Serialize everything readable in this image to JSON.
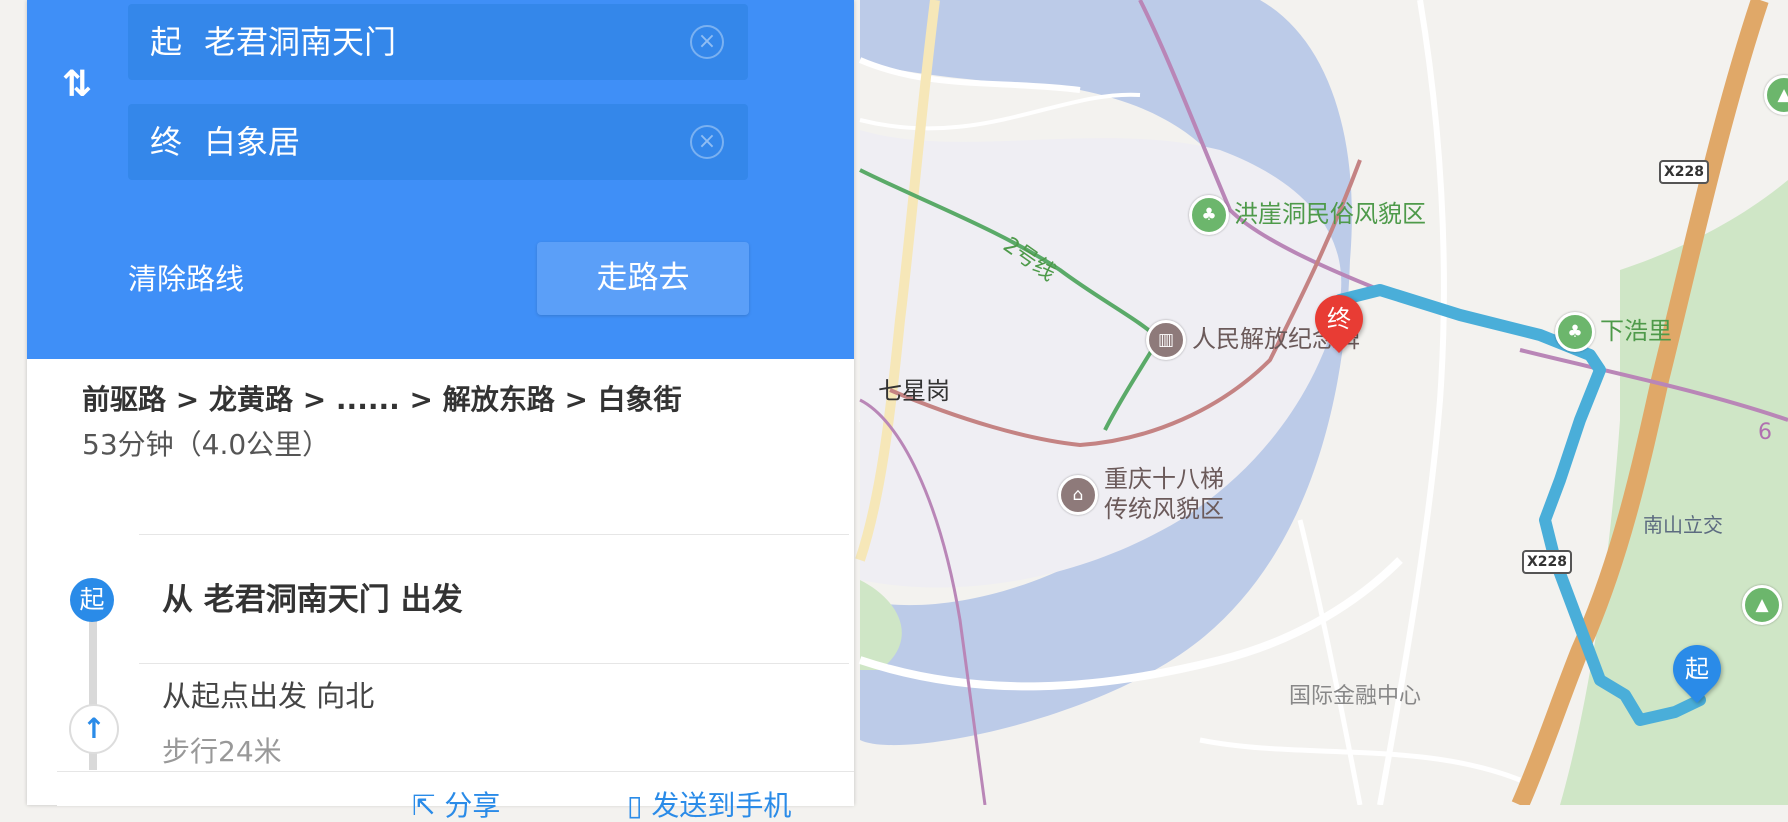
{
  "route_panel": {
    "start_prefix": "起",
    "start_value": "老君洞南天门",
    "end_prefix": "终",
    "end_value": "白象居",
    "swap_icon": "swap-arrows-icon",
    "clear_label": "清除路线",
    "walk_label": "走路去"
  },
  "summary": {
    "route": "前驱路 > 龙黄路 > ...... > 解放东路 > 白象街",
    "time_distance": "53分钟（4.0公里）"
  },
  "steps": {
    "start_badge": "起",
    "start_text": "从 老君洞南天门 出发",
    "step1_text": "从起点出发 向北",
    "step1_distance": "步行24米"
  },
  "bottom": {
    "share_label": "分享",
    "send_label": "发送到手机"
  },
  "map": {
    "pois": {
      "hongyadong": "洪崖洞民俗风貌区",
      "xiahaoli": "下浩里",
      "jiefangbei": "人民解放纪念碑",
      "shibati_1": "重庆十八梯",
      "shibati_2": "传统风貌区",
      "qixinggang": "七星岗",
      "nanshan": "南山立交",
      "ifc": "国际金融中心"
    },
    "metro_line": "2号线",
    "road_shield": "X228",
    "metro_6": "6",
    "pin_end": "终",
    "pin_start": "起"
  },
  "colors": {
    "panel_blue": "#3f8ff7",
    "river": "#bccbe8",
    "route_line": "#4aaed9",
    "highway": "#e0a868",
    "park": "#a8d5a2",
    "pin_red": "#e83c34",
    "pin_blue": "#2a8be8"
  }
}
